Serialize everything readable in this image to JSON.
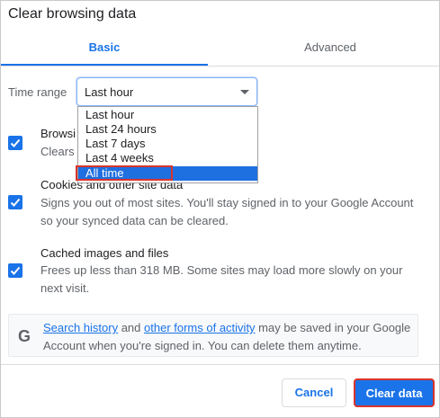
{
  "dialog": {
    "title": "Clear browsing data"
  },
  "tabs": [
    {
      "label": "Basic",
      "active": true
    },
    {
      "label": "Advanced",
      "active": false
    }
  ],
  "time_range": {
    "label": "Time range",
    "selected": "Last hour",
    "options": [
      "Last hour",
      "Last 24 hours",
      "Last 7 days",
      "Last 4 weeks",
      "All time"
    ],
    "highlighted_option": "All time"
  },
  "items": [
    {
      "title": "Browsing history",
      "desc": "Clears history from all synced devices",
      "checked": true
    },
    {
      "title": "Cookies and other site data",
      "desc": "Signs you out of most sites. You'll stay signed in to your Google Account so your synced data can be cleared.",
      "checked": true
    },
    {
      "title": "Cached images and files",
      "desc": "Frees up less than 318 MB. Some sites may load more slowly on your next visit.",
      "checked": true
    }
  ],
  "visible_text": {
    "item1_title_partial": "Browsi",
    "item1_desc_partial": "Clears"
  },
  "info": {
    "icon": "G",
    "link1": "Search history",
    "text1": " and ",
    "link2": "other forms of activity",
    "text2": " may be saved in your Google Account when you're signed in. You can delete them anytime."
  },
  "buttons": {
    "cancel": "Cancel",
    "clear": "Clear data"
  },
  "colors": {
    "accent": "#1a73e8",
    "highlight_border": "#d9342b",
    "selected_option": "#1e6fe0"
  }
}
